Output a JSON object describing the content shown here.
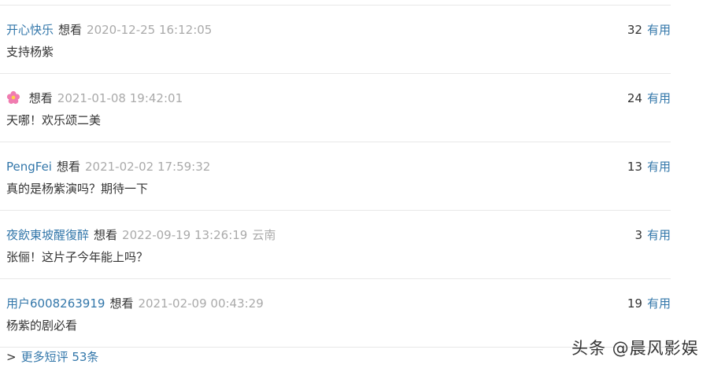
{
  "comments": [
    {
      "user": "开心快乐",
      "status": "想看",
      "time": "2020-12-25 16:12:05",
      "location": "",
      "votes": "32",
      "useful_label": "有用",
      "text": "支持杨紫"
    },
    {
      "user": "",
      "status": "想看",
      "time": "2021-01-08 19:42:01",
      "location": "",
      "votes": "24",
      "useful_label": "有用",
      "text": "天哪！欢乐颂二美"
    },
    {
      "user": "PengFei",
      "status": "想看",
      "time": "2021-02-02 17:59:32",
      "location": "",
      "votes": "13",
      "useful_label": "有用",
      "text": "真的是杨紫演吗？期待一下"
    },
    {
      "user": "夜飲東坡醒復醉",
      "status": "想看",
      "time": "2022-09-19 13:26:19",
      "location": "云南",
      "votes": "3",
      "useful_label": "有用",
      "text": "张俪！这片子今年能上吗？"
    },
    {
      "user": "用户6008263919",
      "status": "想看",
      "time": "2021-02-09 00:43:29",
      "location": "",
      "votes": "19",
      "useful_label": "有用",
      "text": "杨紫的剧必看"
    }
  ],
  "more": {
    "arrow": ">",
    "label": "更多短评 53条"
  },
  "watermark": "头条 @晨风影娱",
  "colors": {
    "link": "#3377aa",
    "text": "#333333",
    "muted": "#aaaaaa",
    "divider": "#e8e8e8",
    "flower": "#e8609a"
  }
}
